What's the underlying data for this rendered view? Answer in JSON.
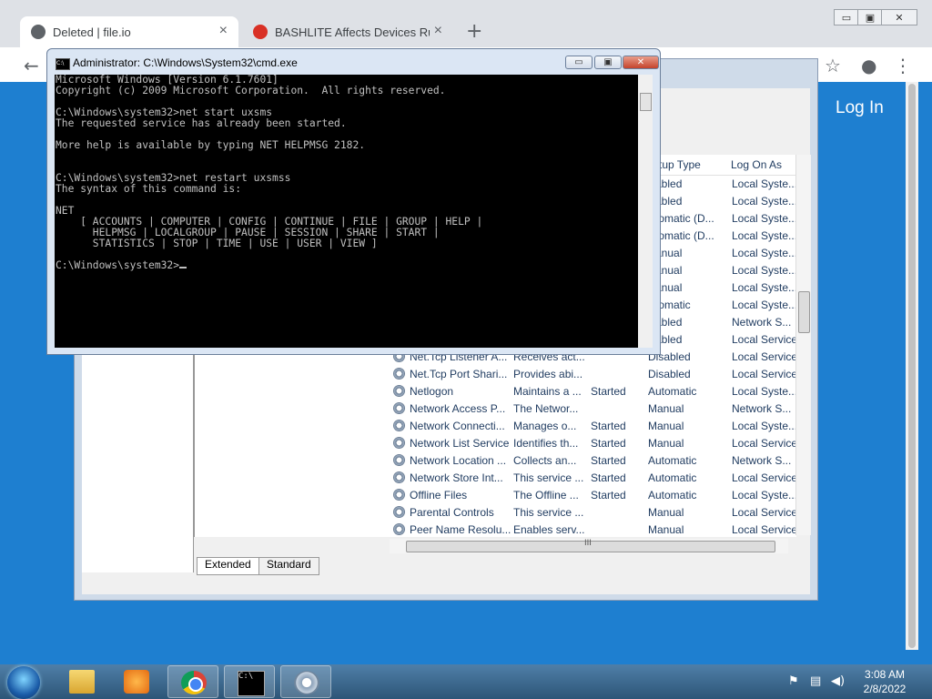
{
  "browser": {
    "tabs": [
      {
        "title": "Deleted | file.io",
        "close": "×"
      },
      {
        "title": "BASHLITE Affects Devices Running",
        "close": "×"
      }
    ],
    "new_tab": "+",
    "window_controls": {
      "minimize": "▭",
      "maximize": "▣",
      "close": "✕"
    },
    "nav": {
      "back": "←"
    },
    "toolbar_icons": {
      "star": "☆",
      "profile": "●",
      "menu": "⋮"
    },
    "page": {
      "login_label": "Log In"
    }
  },
  "services": {
    "columns": {
      "startup_type": "rtup Type",
      "log_on_as": "Log On As"
    },
    "rows": [
      {
        "name": "",
        "description": "",
        "status": "",
        "startup": "abled",
        "logon": "Local Syste..."
      },
      {
        "name": "",
        "description": "",
        "status": "",
        "startup": "abled",
        "logon": "Local Syste..."
      },
      {
        "name": "",
        "description": "",
        "status": "",
        "startup": "tomatic (D...",
        "logon": "Local Syste..."
      },
      {
        "name": "",
        "description": "",
        "status": "",
        "startup": "tomatic (D...",
        "logon": "Local Syste..."
      },
      {
        "name": "",
        "description": "",
        "status": "",
        "startup": "anual",
        "logon": "Local Syste..."
      },
      {
        "name": "",
        "description": "",
        "status": "",
        "startup": "anual",
        "logon": "Local Syste..."
      },
      {
        "name": "",
        "description": "",
        "status": "",
        "startup": "anual",
        "logon": "Local Syste..."
      },
      {
        "name": "",
        "description": "",
        "status": "",
        "startup": "tomatic",
        "logon": "Local Syste..."
      },
      {
        "name": "",
        "description": "",
        "status": "",
        "startup": "abled",
        "logon": "Network S..."
      },
      {
        "name": "",
        "description": "",
        "status": "",
        "startup": "abled",
        "logon": "Local Service"
      },
      {
        "name": "Net.Tcp Listener A...",
        "description": "Receives act...",
        "status": "",
        "startup": "Disabled",
        "logon": "Local Service"
      },
      {
        "name": "Net.Tcp Port Shari...",
        "description": "Provides abi...",
        "status": "",
        "startup": "Disabled",
        "logon": "Local Service"
      },
      {
        "name": "Netlogon",
        "description": "Maintains a ...",
        "status": "Started",
        "startup": "Automatic",
        "logon": "Local Syste..."
      },
      {
        "name": "Network Access P...",
        "description": "The Networ...",
        "status": "",
        "startup": "Manual",
        "logon": "Network S..."
      },
      {
        "name": "Network Connecti...",
        "description": "Manages o...",
        "status": "Started",
        "startup": "Manual",
        "logon": "Local Syste..."
      },
      {
        "name": "Network List Service",
        "description": "Identifies th...",
        "status": "Started",
        "startup": "Manual",
        "logon": "Local Service"
      },
      {
        "name": "Network Location ...",
        "description": "Collects an...",
        "status": "Started",
        "startup": "Automatic",
        "logon": "Network S..."
      },
      {
        "name": "Network Store Int...",
        "description": "This service ...",
        "status": "Started",
        "startup": "Automatic",
        "logon": "Local Service"
      },
      {
        "name": "Offline Files",
        "description": "The Offline ...",
        "status": "Started",
        "startup": "Automatic",
        "logon": "Local Syste..."
      },
      {
        "name": "Parental Controls",
        "description": "This service ...",
        "status": "",
        "startup": "Manual",
        "logon": "Local Service"
      },
      {
        "name": "Peer Name Resolu...",
        "description": "Enables serv...",
        "status": "",
        "startup": "Manual",
        "logon": "Local Service"
      }
    ],
    "view_tabs": {
      "extended": "Extended",
      "standard": "Standard"
    },
    "scroll_grip": "III"
  },
  "cmd": {
    "title": "Administrator: C:\\Windows\\System32\\cmd.exe",
    "icon_text": "C:\\",
    "output": "Microsoft Windows [Version 6.1.7601]\nCopyright (c) 2009 Microsoft Corporation.  All rights reserved.\n\nC:\\Windows\\system32>net start uxsms\nThe requested service has already been started.\n\nMore help is available by typing NET HELPMSG 2182.\n\n\nC:\\Windows\\system32>net restart uxsmss\nThe syntax of this command is:\n\nNET\n    [ ACCOUNTS | COMPUTER | CONFIG | CONTINUE | FILE | GROUP | HELP |\n      HELPMSG | LOCALGROUP | PAUSE | SESSION | SHARE | START |\n      STATISTICS | STOP | TIME | USE | USER | VIEW ]\n\nC:\\Windows\\system32>",
    "buttons": {
      "minimize": "▭",
      "maximize": "▣",
      "close": "✕"
    }
  },
  "taskbar": {
    "apps": [
      {
        "name": "explorer"
      },
      {
        "name": "media-player"
      },
      {
        "name": "chrome"
      },
      {
        "name": "cmd",
        "icon_text": "C:\\"
      },
      {
        "name": "services"
      }
    ],
    "tray_icons": [
      "network-alert",
      "network",
      "volume"
    ],
    "clock": {
      "time": "3:08 AM",
      "date": "2/8/2022"
    }
  },
  "colors": {
    "cmd_bg": "#000000",
    "cmd_fg": "#c0c0c0",
    "page_blue": "#1e7fd0",
    "chrome_red": "#d93025"
  }
}
